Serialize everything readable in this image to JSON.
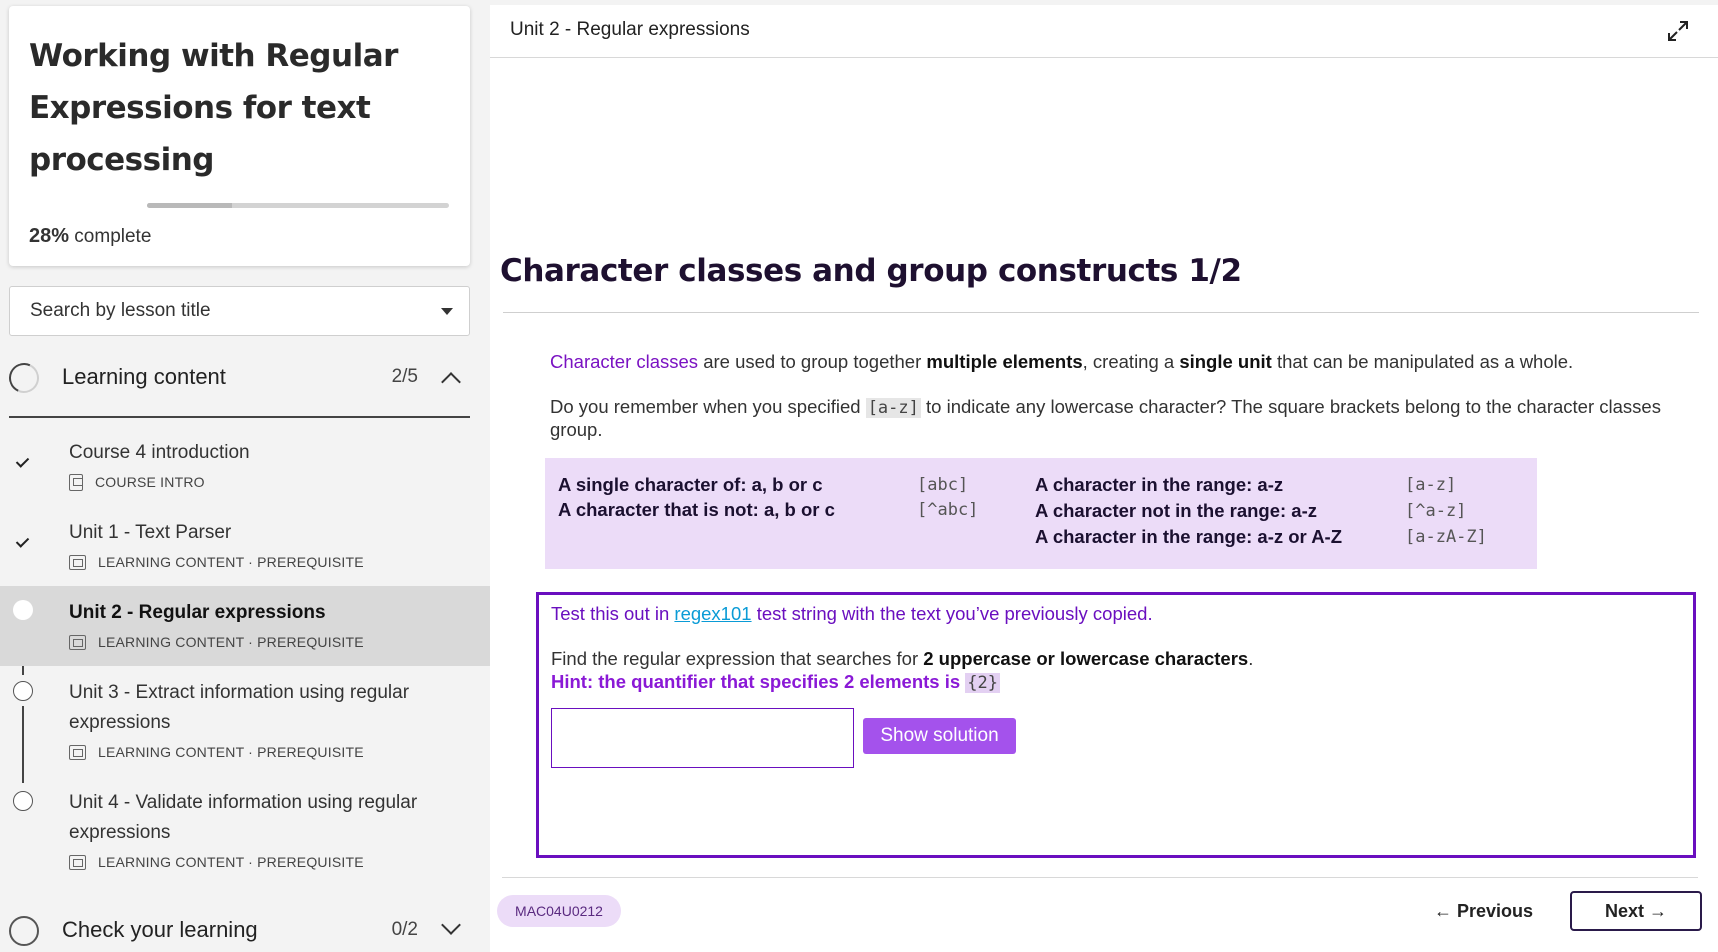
{
  "sidebar": {
    "course_title": "Working with Regular Expressions for text processing",
    "progress_percent": 28,
    "progress_value": "28%",
    "progress_suffix": " complete",
    "search_placeholder": "Search by lesson title",
    "sections": [
      {
        "label": "Learning content",
        "count": "2/5",
        "expanded": true
      },
      {
        "label": "Check your learning",
        "count": "0/2",
        "expanded": false
      }
    ],
    "lessons": [
      {
        "title": "Course 4 introduction",
        "meta": "COURSE INTRO",
        "status": "done"
      },
      {
        "title": "Unit 1 - Text Parser",
        "meta": "LEARNING CONTENT · PREREQUISITE",
        "status": "done"
      },
      {
        "title": "Unit 2 - Regular expressions",
        "meta": "LEARNING CONTENT · PREREQUISITE",
        "status": "current"
      },
      {
        "title": "Unit 3 - Extract information using regular expressions",
        "meta": "LEARNING CONTENT · PREREQUISITE",
        "status": "todo"
      },
      {
        "title": "Unit 4 - Validate information using regular expressions",
        "meta": "LEARNING CONTENT · PREREQUISITE",
        "status": "todo"
      }
    ]
  },
  "main": {
    "header_title": "Unit 2 - Regular expressions",
    "heading": "Character classes and group constructs 1/2",
    "para1": {
      "term": "Character classes",
      "t1": " are used to group together ",
      "b1": "multiple elements",
      "t2": ", creating a ",
      "b2": "single unit",
      "t3": " that can be manipulated as a whole."
    },
    "para2": {
      "t1": "Do you remember when you specified ",
      "code": "[a-z]",
      "t2": " to indicate any lowercase character? The square brackets belong to the character classes group."
    },
    "reference": {
      "left": [
        {
          "label": "A single character of: a, b or c",
          "pattern": "[abc]"
        },
        {
          "label": "A character that is not: a, b or c",
          "pattern": "[^abc]"
        }
      ],
      "right": [
        {
          "label": "A character in the range: a-z",
          "pattern": "[a-z]"
        },
        {
          "label": "A character not in the range: a-z",
          "pattern": "[^a-z]"
        },
        {
          "label": "A character in the range: a-z or A-Z",
          "pattern": "[a-zA-Z]"
        }
      ]
    },
    "exercise": {
      "l1_before": "Test this out in ",
      "link": "regex101",
      "l1_after": " test string with the text you’ve previously copied.",
      "l2_before": "Find the regular expression that searches for ",
      "l2_bold": "2 uppercase or lowercase characters",
      "l2_after": ".",
      "hint": "Hint: the quantifier that specifies 2 elements is ",
      "hint_code": "{2}",
      "input_value": "",
      "button": "Show solution"
    },
    "footer": {
      "code": "MAC04U0212",
      "previous": "← Previous",
      "next": "Next →"
    }
  },
  "colors": {
    "accent": "#6a0fbf",
    "button_purple": "#a452ec",
    "reference_bg": "#ecdcf8",
    "link": "#0a9bd6"
  },
  "icons": [
    "chevron-up-icon",
    "chevron-down-icon",
    "caret-down-icon",
    "check-icon",
    "expand-icon",
    "lesson-doc-icon",
    "lesson-screen-icon"
  ]
}
